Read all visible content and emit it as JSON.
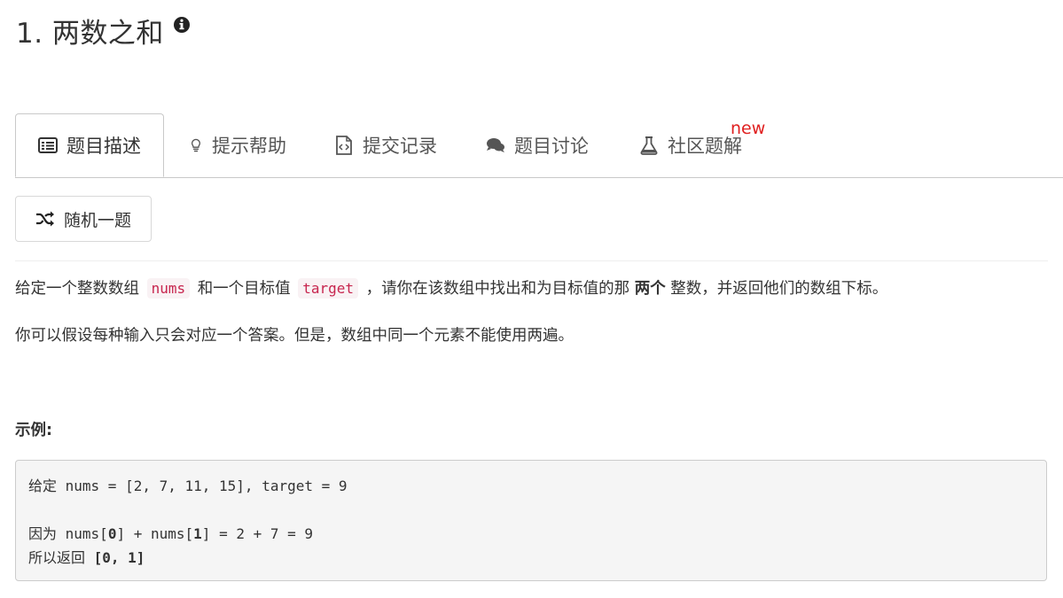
{
  "problem": {
    "title": "1. 两数之和",
    "info_icon": "info-circle-icon"
  },
  "tabs": [
    {
      "label": "题目描述",
      "icon": "list-icon",
      "active": true
    },
    {
      "label": "提示帮助",
      "icon": "lightbulb-icon",
      "active": false
    },
    {
      "label": "提交记录",
      "icon": "code-file-icon",
      "active": false
    },
    {
      "label": "题目讨论",
      "icon": "comments-icon",
      "active": false
    },
    {
      "label": "社区题解",
      "icon": "flask-icon",
      "active": false,
      "badge": "new"
    }
  ],
  "random_button": {
    "label": "随机一题",
    "icon": "shuffle-icon"
  },
  "description": {
    "p1_a": "给定一个整数数组",
    "p1_code1": "nums",
    "p1_b": "和一个目标值",
    "p1_code2": "target",
    "p1_c": "，请你在该数组中找出和为目标值的那",
    "p1_bold": "两个",
    "p1_d": "整数，并返回他们的数组下标。",
    "p2": "你可以假设每种输入只会对应一个答案。但是，数组中同一个元素不能使用两遍。"
  },
  "example": {
    "label": "示例:",
    "line1": "给定 nums = [2, 7, 11, 15], target = 9",
    "line2": "",
    "line3_a": "因为 nums[",
    "line3_b": "0",
    "line3_c": "] + nums[",
    "line3_d": "1",
    "line3_e": "] = 2 + 7 = 9",
    "line4_a": "所以返回 ",
    "line4_b": "[0, 1]"
  },
  "colors": {
    "badge": "#e02020",
    "inline_code_text": "#c7254e",
    "inline_code_bg": "#f9f2f4",
    "pre_bg": "#f5f5f5"
  }
}
